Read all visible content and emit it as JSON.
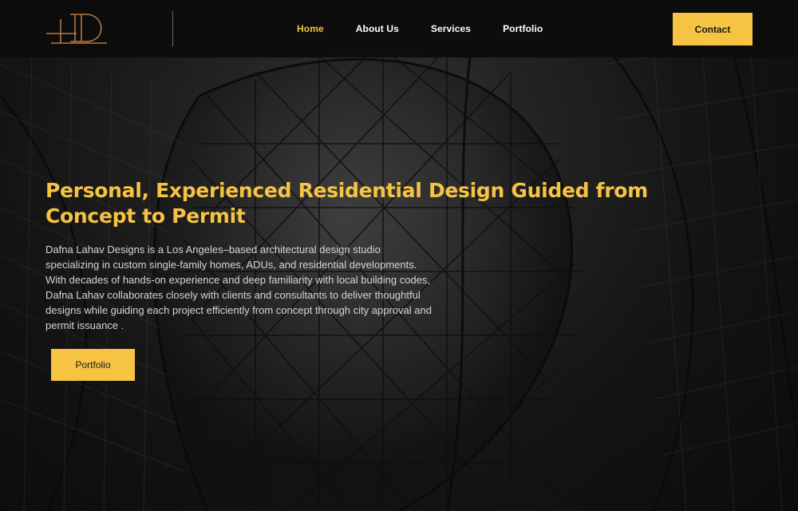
{
  "header": {
    "logo_icon": "ld-monogram-icon",
    "nav": [
      {
        "label": "Home",
        "active": true
      },
      {
        "label": "About Us",
        "active": false
      },
      {
        "label": "Services",
        "active": false
      },
      {
        "label": "Portfolio",
        "active": false
      }
    ],
    "contact_label": "Contact"
  },
  "hero": {
    "title": "Personal, Experienced Residential Design Guided from Concept to Permit",
    "description": "Dafna Lahav Designs is a Los Angeles–based architectural design studio specializing in custom single-family homes, ADUs, and residential developments. With decades of hands-on experience and deep familiarity with local building codes, Dafna Lahav collaborates closely with clients and consultants to deliver thoughtful designs while guiding each project efficiently from concept through city approval and permit issuance .",
    "cta_label": "Portfolio"
  },
  "colors": {
    "accent": "#f6c343",
    "header_bg": "#0c0c0c",
    "logo_bronze": "#b9763f",
    "text_light": "#d6d6d6"
  }
}
